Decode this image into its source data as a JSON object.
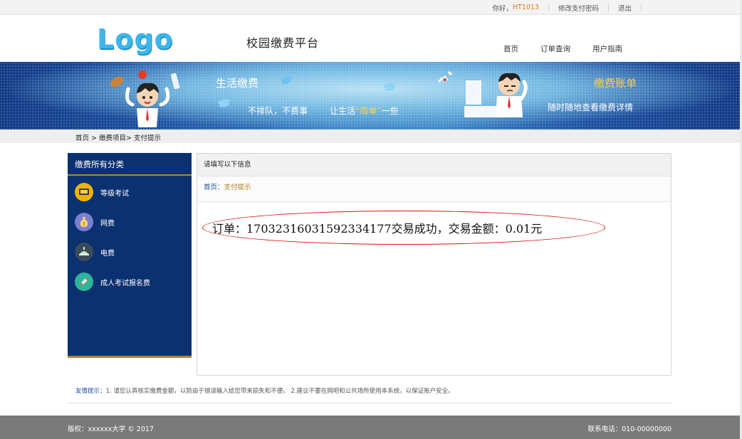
{
  "topbar": {
    "greeting": "你好，",
    "username": "HT1013",
    "change_password": "修改支付密码",
    "logout": "退出"
  },
  "header": {
    "logo": "Logo",
    "site_title": "校园缴费平台",
    "nav": [
      "首页",
      "订单查询",
      "用户指南"
    ]
  },
  "banner": {
    "left_title": "生活缴费",
    "slogan1": "不排队，不费事",
    "slogan2_pre": "让生活",
    "slogan2_quote": "“简单”",
    "slogan2_post": "一些",
    "right_title": "缴费账单",
    "right_sub": "随时随地查看缴费详情"
  },
  "breadcrumb": "首页 > 缴费项目> 支付提示",
  "sidebar": {
    "title": "缴费所有分类",
    "items": [
      {
        "label": "等级考试",
        "icon": "exam-icon",
        "color": "#f0b400"
      },
      {
        "label": "网费",
        "icon": "money-bag-icon",
        "color": "#7b7fd0"
      },
      {
        "label": "电费",
        "icon": "lamp-icon",
        "color": "#3b4a5a"
      },
      {
        "label": "成人考试报名费",
        "icon": "pencil-icon",
        "color": "#2bb59a"
      }
    ]
  },
  "panel": {
    "header": "请填写以下信息",
    "crumb_home": "首页",
    "crumb_sep": "：",
    "crumb_current": "支付提示",
    "message": "订单：17032316031592334177交易成功，交易金额：0.01元"
  },
  "tips": {
    "label": "友情提示：",
    "text": "1. 请您认真核实缴费金额，以防由于错误输入给您带来损失和不便。   2.建议不要在网吧和公共场所使用本系统，以保证账户安全。"
  },
  "footer": {
    "copyright": "版权：xxxxxx大学 © 2017",
    "phone": "联系电话：010-00000000"
  }
}
